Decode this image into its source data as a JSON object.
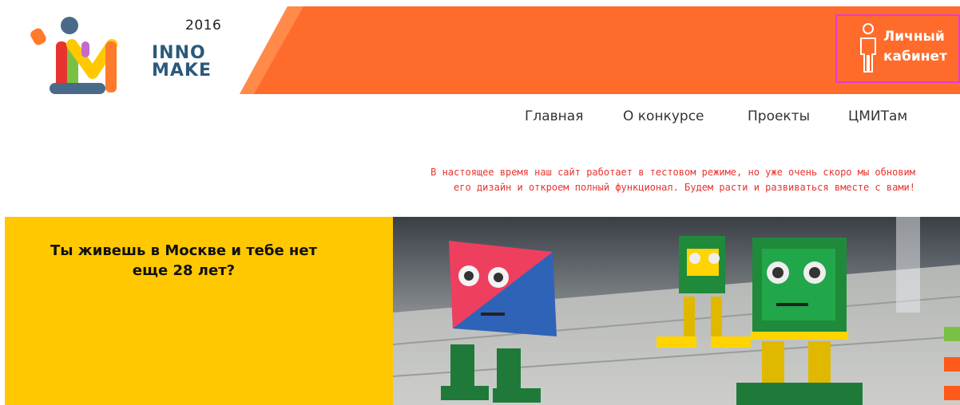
{
  "colors": {
    "orange": "#ff6b2b",
    "orange_dark": "#e85e22",
    "yellow": "#ffc800",
    "notice_red": "#e8342f",
    "login_border": "#e53ad8",
    "dot_green": "#7ac143",
    "dot_orange": "#ff5a1a"
  },
  "logo": {
    "year": "2016",
    "name": "INNO MAKE",
    "icon": "innomake-logo-icon"
  },
  "login": {
    "label": "Личный\nкабинет",
    "icon": "person-icon"
  },
  "nav": {
    "items": [
      "Главная",
      "О конкурсе",
      "Проекты",
      "ЦМИТам"
    ]
  },
  "notice": {
    "line1": "В настоящее время наш сайт работает в тестовом режиме, но уже очень скоро мы обновим",
    "line2": "его дизайн и откроем полный функционал. Будем расти и развиваться вместе с вами!"
  },
  "hero": {
    "text": "Ты живешь в Москве и тебе нет еще 28 лет?",
    "image": "robots-photo"
  },
  "slider": {
    "dots": [
      "dot_green",
      "dot_orange",
      "dot_orange"
    ]
  }
}
